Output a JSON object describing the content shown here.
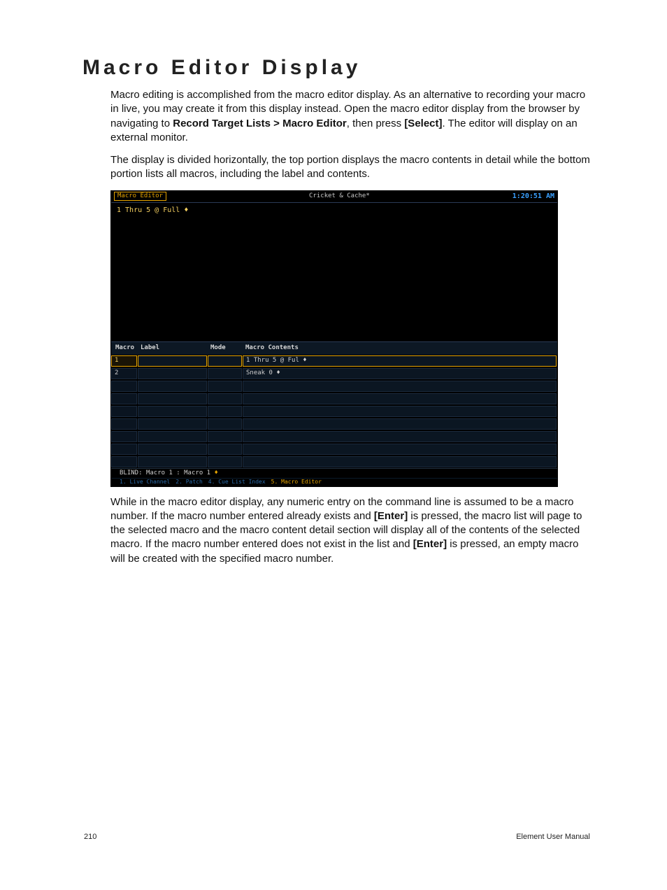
{
  "heading": "Macro Editor Display",
  "para1_a": "Macro editing is accomplished from the macro editor display. As an alternative to recording your macro in live, you may create it from this display instead. Open the macro editor display from the browser by navigating to ",
  "para1_b": "Record Target Lists > Macro Editor",
  "para1_c": ", then press ",
  "para1_d": "[Select]",
  "para1_e": ". The editor will display on an external monitor.",
  "para2": "The display is divided horizontally, the top portion displays the macro contents in detail while the bottom portion lists all macros, including the label and contents.",
  "para3_a": "While in the macro editor display, any numeric entry on the command line is assumed to be a macro number. If the macro number entered already exists and ",
  "para3_b": "[Enter]",
  "para3_c": " is pressed, the macro list will page to the selected macro and the macro content detail section will display all of the contents of the selected macro. If the macro number entered does not exist in the list and ",
  "para3_d": "[Enter]",
  "para3_e": " is pressed, an empty macro will be created with the specified macro number.",
  "screenshot": {
    "tab_label": "Macro Editor",
    "show_name": "Cricket & Cache*",
    "clock": "1:20:51 AM",
    "detail_text": "1 Thru 5 @ Full ♦",
    "headers": {
      "macro": "Macro",
      "label": "Label",
      "mode": "Mode",
      "contents": "Macro Contents"
    },
    "rows": [
      {
        "macro": "1",
        "label": "",
        "mode": "",
        "contents": "1 Thru 5 @ Ful ♦",
        "selected": true
      },
      {
        "macro": "2",
        "label": "",
        "mode": "",
        "contents": "Sneak 0 ♦",
        "selected": false
      }
    ],
    "empty_row_count": 7,
    "command_line": {
      "prefix": "BLIND: ",
      "a": "Macro 1",
      "sep": " : ",
      "b": "Macro 1",
      "dia": " ♦"
    },
    "bottom_tabs": [
      "1. Live Channel",
      "2. Patch",
      "4. Cue List Index",
      "5. Macro Editor"
    ],
    "bottom_active_index": 3
  },
  "footer": {
    "page": "210",
    "manual": "Element User Manual"
  }
}
